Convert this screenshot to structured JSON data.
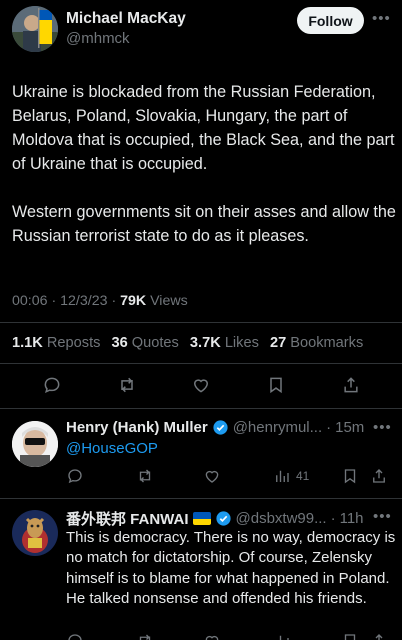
{
  "main_tweet": {
    "author_name": "Michael MacKay",
    "author_handle": "@mhmck",
    "follow_label": "Follow",
    "paragraphs": [
      "Ukraine is blockaded from the Russian Federation, Belarus, Poland, Slovakia, Hungary, the part of Moldova that is occupied, the Black Sea, and the part of Ukraine that is occupied.",
      "Western governments sit on their asses and allow the Russian terrorist state to do as it pleases."
    ],
    "time": "00:06",
    "date": "12/3/23",
    "views_count": "79K",
    "views_label": "Views",
    "stats": {
      "reposts_count": "1.1K",
      "reposts_label": "Reposts",
      "quotes_count": "36",
      "quotes_label": "Quotes",
      "likes_count": "3.7K",
      "likes_label": "Likes",
      "bookmarks_count": "27",
      "bookmarks_label": "Bookmarks"
    },
    "actions": [
      "reply-icon",
      "repost-icon",
      "like-icon",
      "bookmark-icon",
      "share-icon"
    ]
  },
  "replies": [
    {
      "author_name": "Henry (Hank) Muller",
      "author_handle": "@henrymul...",
      "time": "15m",
      "text": "@HouseGOP",
      "views": "41",
      "verified": true
    },
    {
      "author_name": "番外联邦 FANWAI",
      "author_handle": "@dsbxtw99...",
      "time": "11h",
      "text": "This is democracy. There is no way, democracy is no match for dictatorship. Of course, Zelensky himself is to blame for what happened in Poland. He talked nonsense and offended his friends.",
      "verified": true
    }
  ],
  "colors": {
    "accent": "#1d9bf0",
    "text": "#e7e9ea",
    "muted": "#71767b",
    "divider": "#2f3336",
    "background": "#000000"
  }
}
